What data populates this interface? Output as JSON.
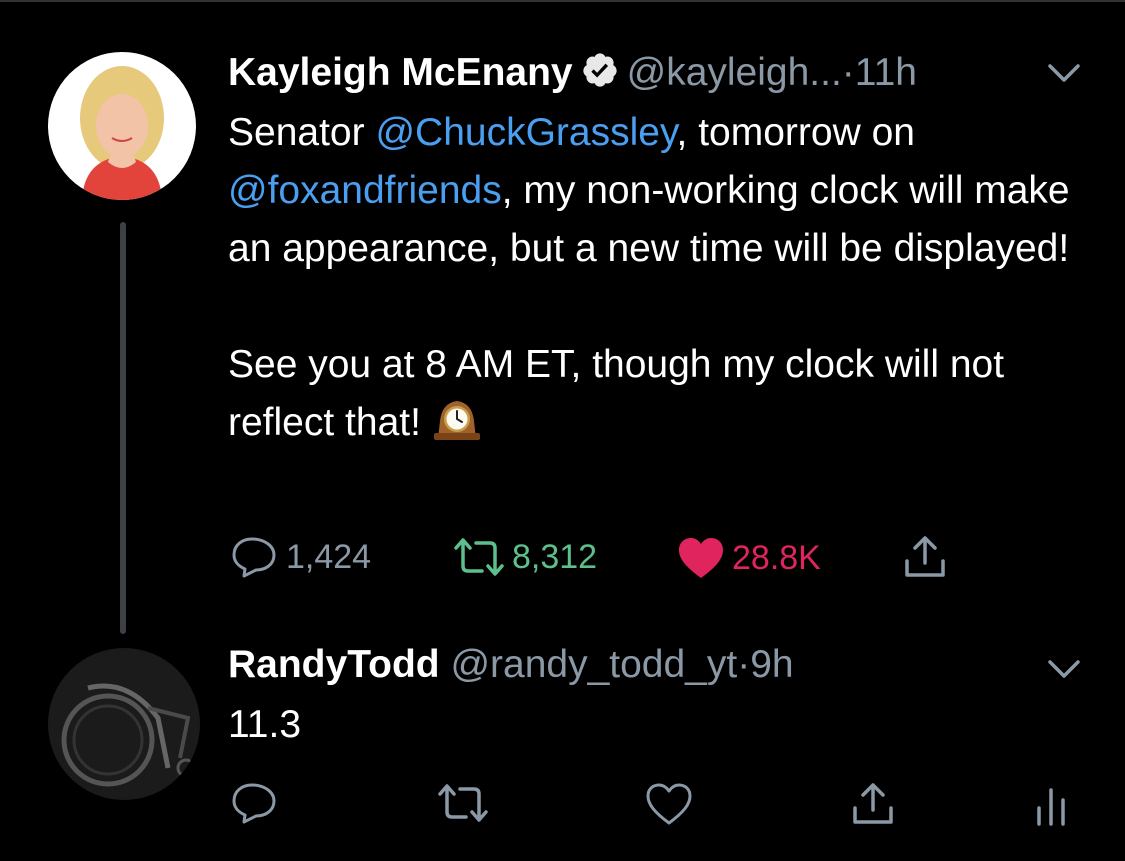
{
  "colors": {
    "background": "#000000",
    "text": "#ffffff",
    "secondary": "#8b98a5",
    "link": "#4a9ff0",
    "retweet_green": "#5dc08c",
    "like_red": "#e0245e"
  },
  "tweet": {
    "author_name": "Kayleigh McEnany",
    "author_handle": "@kayleigh...",
    "dot": "·",
    "time": "11h",
    "verified": true,
    "text": {
      "p1_before": "Senator ",
      "mention1": "@ChuckGrassley",
      "p1_middle": ", tomorrow on ",
      "mention2": "@foxandfriends",
      "p1_after": ", my non-working clock will make an appearance, but a new time will be displayed!",
      "p2": "See you at 8 AM ET, though my clock will not reflect that! ",
      "emoji": "mantelpiece-clock-emoji"
    },
    "stats": {
      "replies": "1,424",
      "retweets": "8,312",
      "likes": "28.8K"
    },
    "retweeted": true,
    "liked": true
  },
  "reply": {
    "author_name": "RandyTodd",
    "author_handle": "@randy_todd_yt",
    "dot": "·",
    "time": "9h",
    "text": "11.3"
  },
  "icons": {
    "reply": "reply-bubble-icon",
    "retweet": "retweet-icon",
    "like": "heart-icon",
    "share": "share-icon",
    "analytics": "analytics-icon",
    "caret": "chevron-down-icon",
    "verified": "verified-badge-icon"
  }
}
